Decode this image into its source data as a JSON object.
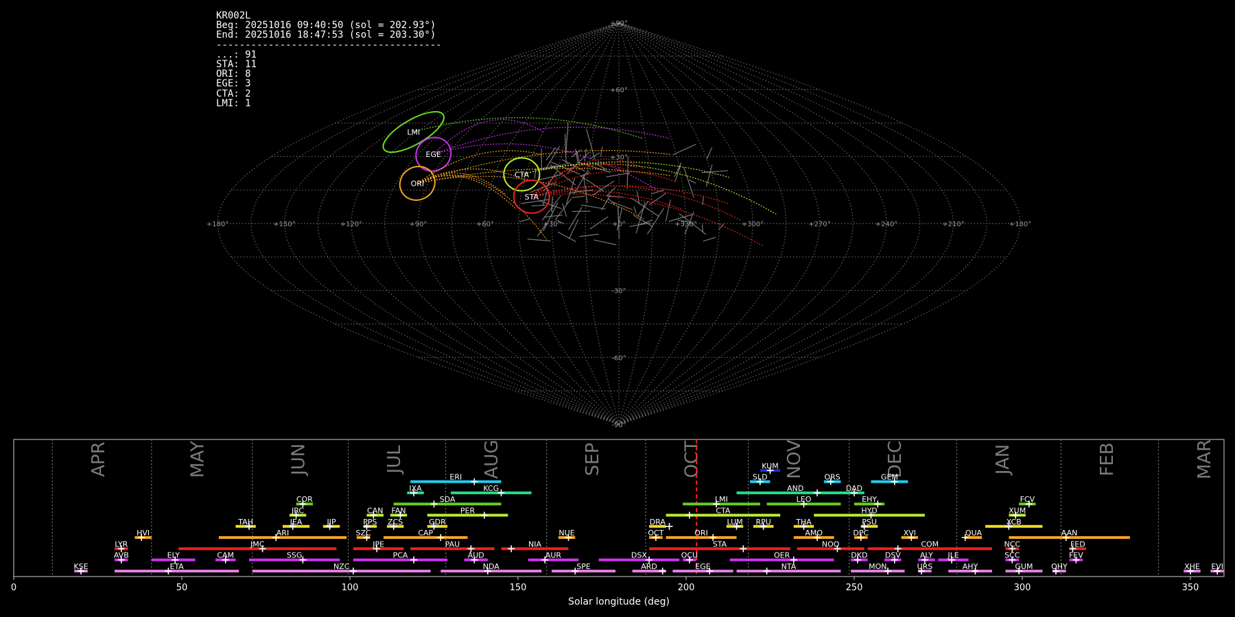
{
  "header": {
    "lines": [
      "KR002L",
      "Beg: 20251016 09:40:50 (sol = 202.93°)",
      "End: 20251016 18:47:53 (sol = 203.30°)",
      "---------------------------------------",
      "...: 91",
      "STA: 11",
      "ORI: 8",
      "EGE: 3",
      "CTA: 2",
      "LMI: 1"
    ]
  },
  "chart_data": [
    {
      "type": "scatter",
      "projection": "sinusoidal (all-sky radiant map)",
      "lon_ticks": [
        "+180°",
        "+150°",
        "+120°",
        "+90°",
        "+60°",
        "+30°",
        "+0°",
        "+330°",
        "+300°",
        "+270°",
        "+240°",
        "+210°",
        "+180°"
      ],
      "lat_ticks": [
        "+90°",
        "+60°",
        "+30°",
        "-30°",
        "-60°",
        "-90°"
      ],
      "sporadic_count": 91,
      "showers": [
        {
          "code": "LMI",
          "count": 1,
          "color": "#66dd22",
          "lon": 122,
          "lat": 41
        },
        {
          "code": "EGE",
          "count": 3,
          "color": "#cc33ee",
          "lon": 97,
          "lat": 31
        },
        {
          "code": "ORI",
          "count": 8,
          "color": "#f5a623",
          "lon": 95,
          "lat": 18
        },
        {
          "code": "CTA",
          "count": 2,
          "color": "#bbee33",
          "lon": 47,
          "lat": 22
        },
        {
          "code": "STA",
          "count": 11,
          "color": "#ee2222",
          "lon": 40,
          "lat": 12
        }
      ]
    },
    {
      "type": "gantt",
      "xlabel": "Solar longitude (deg)",
      "xlim": [
        0,
        360
      ],
      "x_ticks": [
        0,
        50,
        100,
        150,
        200,
        250,
        300,
        350
      ],
      "current_sol": 203.1,
      "months": [
        {
          "name": "APR",
          "start": 11.5
        },
        {
          "name": "MAY",
          "start": 41
        },
        {
          "name": "JUN",
          "start": 71
        },
        {
          "name": "JUL",
          "start": 99.5
        },
        {
          "name": "AUG",
          "start": 128.5
        },
        {
          "name": "SEP",
          "start": 158.5
        },
        {
          "name": "OCT",
          "start": 188
        },
        {
          "name": "NOV",
          "start": 218.5
        },
        {
          "name": "DEC",
          "start": 248.5
        },
        {
          "name": "JAN",
          "start": 280.5
        },
        {
          "name": "FEB",
          "start": 311.5
        },
        {
          "name": "MAR",
          "start": 340.5
        }
      ],
      "showers": [
        {
          "code": "KUM",
          "start": 222,
          "end": 228,
          "peak": 225,
          "row": 10,
          "color": "#1c2fd8"
        },
        {
          "code": "ERI",
          "start": 118,
          "end": 145,
          "peak": 137,
          "row": 9,
          "color": "#22ccee"
        },
        {
          "code": "SLD",
          "start": 219,
          "end": 225,
          "peak": 222,
          "row": 9,
          "color": "#22ccee"
        },
        {
          "code": "ORS",
          "start": 241,
          "end": 246,
          "peak": 243,
          "row": 9,
          "color": "#22ccee"
        },
        {
          "code": "GEM",
          "start": 255,
          "end": 266,
          "peak": 262,
          "row": 9,
          "color": "#22ccee"
        },
        {
          "code": "IXA",
          "start": 117,
          "end": 122,
          "peak": 119,
          "row": 8,
          "color": "#22dd88"
        },
        {
          "code": "KCG",
          "start": 130,
          "end": 154,
          "peak": 145,
          "row": 8,
          "color": "#22dd88"
        },
        {
          "code": "AND",
          "start": 215,
          "end": 250,
          "peak": 239,
          "row": 8,
          "color": "#22dd88"
        },
        {
          "code": "DAD",
          "start": 247,
          "end": 253,
          "peak": 250,
          "row": 8,
          "color": "#22dd88"
        },
        {
          "code": "COR",
          "start": 84,
          "end": 89,
          "peak": 86,
          "row": 7,
          "color": "#66cc22"
        },
        {
          "code": "SDA",
          "start": 113,
          "end": 145,
          "peak": 125,
          "row": 7,
          "color": "#66cc22"
        },
        {
          "code": "LMI",
          "start": 199,
          "end": 222,
          "peak": 209,
          "row": 7,
          "color": "#66cc22"
        },
        {
          "code": "LEO",
          "start": 224,
          "end": 246,
          "peak": 235,
          "row": 7,
          "color": "#66cc22"
        },
        {
          "code": "EHY",
          "start": 250,
          "end": 259,
          "peak": 257,
          "row": 7,
          "color": "#66cc22"
        },
        {
          "code": "FCV",
          "start": 299,
          "end": 304,
          "peak": 302,
          "row": 7,
          "color": "#66cc22"
        },
        {
          "code": "JRC",
          "start": 82,
          "end": 87,
          "peak": 84,
          "row": 6,
          "color": "#bbee33"
        },
        {
          "code": "CAN",
          "start": 105,
          "end": 110,
          "peak": 107,
          "row": 6,
          "color": "#bbee33"
        },
        {
          "code": "FAN",
          "start": 112,
          "end": 117,
          "peak": 115,
          "row": 6,
          "color": "#bbee33"
        },
        {
          "code": "PER",
          "start": 123,
          "end": 147,
          "peak": 140,
          "row": 6,
          "color": "#bbee33"
        },
        {
          "code": "CTA",
          "start": 194,
          "end": 228,
          "peak": 201,
          "row": 6,
          "color": "#bbee33"
        },
        {
          "code": "HYD",
          "start": 238,
          "end": 271,
          "peak": 255,
          "row": 6,
          "color": "#bbee33"
        },
        {
          "code": "XUM",
          "start": 296,
          "end": 301,
          "peak": 298,
          "row": 6,
          "color": "#bbee33"
        },
        {
          "code": "TAH",
          "start": 66,
          "end": 72,
          "peak": 70,
          "row": 5,
          "color": "#eedd22"
        },
        {
          "code": "JEA",
          "start": 80,
          "end": 88,
          "peak": 83,
          "row": 5,
          "color": "#eedd22"
        },
        {
          "code": "JIP",
          "start": 92,
          "end": 97,
          "peak": 94,
          "row": 5,
          "color": "#eedd22"
        },
        {
          "code": "PPS",
          "start": 104,
          "end": 108,
          "peak": 105,
          "row": 5,
          "color": "#eedd22"
        },
        {
          "code": "ZCS",
          "start": 111,
          "end": 116,
          "peak": 113,
          "row": 5,
          "color": "#eedd22"
        },
        {
          "code": "GDR",
          "start": 123,
          "end": 129,
          "peak": 125,
          "row": 5,
          "color": "#eedd22"
        },
        {
          "code": "DRA",
          "start": 189,
          "end": 194,
          "peak": 195,
          "row": 5,
          "color": "#eedd22"
        },
        {
          "code": "LUM",
          "start": 212,
          "end": 217,
          "peak": 215,
          "row": 5,
          "color": "#eedd22"
        },
        {
          "code": "RPU",
          "start": 220,
          "end": 226,
          "peak": 223,
          "row": 5,
          "color": "#eedd22"
        },
        {
          "code": "THA",
          "start": 232,
          "end": 238,
          "peak": 235,
          "row": 5,
          "color": "#eedd22"
        },
        {
          "code": "PSU",
          "start": 252,
          "end": 257,
          "peak": 253,
          "row": 5,
          "color": "#eedd22"
        },
        {
          "code": "XCB",
          "start": 289,
          "end": 306,
          "peak": 296,
          "row": 5,
          "color": "#eedd22"
        },
        {
          "code": "HVI",
          "start": 36,
          "end": 41,
          "peak": 38,
          "row": 4,
          "color": "#f5a623"
        },
        {
          "code": "ARI",
          "start": 61,
          "end": 99,
          "peak": 78,
          "row": 4,
          "color": "#f5a623"
        },
        {
          "code": "SZC",
          "start": 102,
          "end": 106,
          "peak": 105,
          "row": 4,
          "color": "#f5a623"
        },
        {
          "code": "CAP",
          "start": 110,
          "end": 135,
          "peak": 127,
          "row": 4,
          "color": "#f5a623"
        },
        {
          "code": "NUE",
          "start": 162,
          "end": 167,
          "peak": 165,
          "row": 4,
          "color": "#f5a623"
        },
        {
          "code": "OCT",
          "start": 189,
          "end": 193,
          "peak": 191,
          "row": 4,
          "color": "#f5a623"
        },
        {
          "code": "ORI",
          "start": 194,
          "end": 215,
          "peak": 208,
          "row": 4,
          "color": "#f5a623"
        },
        {
          "code": "AMO",
          "start": 232,
          "end": 244,
          "peak": 239,
          "row": 4,
          "color": "#f5a623"
        },
        {
          "code": "DPC",
          "start": 250,
          "end": 254,
          "peak": 252,
          "row": 4,
          "color": "#f5a623"
        },
        {
          "code": "XVI",
          "start": 264,
          "end": 269,
          "peak": 267,
          "row": 4,
          "color": "#f5a623"
        },
        {
          "code": "QUA",
          "start": 283,
          "end": 288,
          "peak": 283,
          "row": 4,
          "color": "#f5a623"
        },
        {
          "code": "AAN",
          "start": 296,
          "end": 332,
          "peak": 313,
          "row": 4,
          "color": "#f5a623"
        },
        {
          "code": "LYR",
          "start": 30,
          "end": 34,
          "peak": 32,
          "row": 3,
          "color": "#ee2222"
        },
        {
          "code": "JMC",
          "start": 49,
          "end": 96,
          "peak": 74,
          "row": 3,
          "color": "#ee2222"
        },
        {
          "code": "JPE",
          "start": 101,
          "end": 116,
          "peak": 108,
          "row": 3,
          "color": "#ee2222"
        },
        {
          "code": "PAU",
          "start": 118,
          "end": 143,
          "peak": 136,
          "row": 3,
          "color": "#ee2222"
        },
        {
          "code": "NIA",
          "start": 145,
          "end": 165,
          "peak": 148,
          "row": 3,
          "color": "#ee2222"
        },
        {
          "code": "STA",
          "start": 189,
          "end": 231,
          "peak": 217,
          "row": 3,
          "color": "#ee2222"
        },
        {
          "code": "NOO",
          "start": 233,
          "end": 253,
          "peak": 245,
          "row": 3,
          "color": "#ee2222"
        },
        {
          "code": "COM",
          "start": 254,
          "end": 291,
          "peak": 263,
          "row": 3,
          "color": "#ee2222"
        },
        {
          "code": "NCC",
          "start": 295,
          "end": 299,
          "peak": 297,
          "row": 3,
          "color": "#ee2222"
        },
        {
          "code": "FED",
          "start": 314,
          "end": 319,
          "peak": 315,
          "row": 3,
          "color": "#ee2222"
        },
        {
          "code": "AVB",
          "start": 30,
          "end": 34,
          "peak": 32,
          "row": 2,
          "color": "#cc33ee"
        },
        {
          "code": "ELY",
          "start": 41,
          "end": 54,
          "peak": 48,
          "row": 2,
          "color": "#cc33ee"
        },
        {
          "code": "CAM",
          "start": 60,
          "end": 66,
          "peak": 63,
          "row": 2,
          "color": "#cc33ee"
        },
        {
          "code": "SSG",
          "start": 70,
          "end": 97,
          "peak": 86,
          "row": 2,
          "color": "#cc33ee"
        },
        {
          "code": "PCA",
          "start": 101,
          "end": 129,
          "peak": 119,
          "row": 2,
          "color": "#cc33ee"
        },
        {
          "code": "AUD",
          "start": 134,
          "end": 141,
          "peak": 137,
          "row": 2,
          "color": "#cc33ee"
        },
        {
          "code": "AUR",
          "start": 153,
          "end": 168,
          "peak": 158,
          "row": 2,
          "color": "#cc33ee"
        },
        {
          "code": "DSX",
          "start": 174,
          "end": 198,
          "peak": 189,
          "row": 2,
          "color": "#cc33ee"
        },
        {
          "code": "OCU",
          "start": 199,
          "end": 203,
          "peak": 201,
          "row": 2,
          "color": "#cc33ee"
        },
        {
          "code": "OER",
          "start": 213,
          "end": 244,
          "peak": 232,
          "row": 2,
          "color": "#cc33ee"
        },
        {
          "code": "DKD",
          "start": 249,
          "end": 254,
          "peak": 251,
          "row": 2,
          "color": "#cc33ee"
        },
        {
          "code": "DSV",
          "start": 259,
          "end": 264,
          "peak": 262,
          "row": 2,
          "color": "#cc33ee"
        },
        {
          "code": "ALY",
          "start": 269,
          "end": 274,
          "peak": 271,
          "row": 2,
          "color": "#cc33ee"
        },
        {
          "code": "JLE",
          "start": 275,
          "end": 284,
          "peak": 279,
          "row": 2,
          "color": "#cc33ee"
        },
        {
          "code": "SCC",
          "start": 295,
          "end": 299,
          "peak": 297,
          "row": 2,
          "color": "#cc33ee"
        },
        {
          "code": "FEV",
          "start": 314,
          "end": 318,
          "peak": 316,
          "row": 2,
          "color": "#cc33ee"
        },
        {
          "code": "KSE",
          "start": 18,
          "end": 22,
          "peak": 20,
          "row": 1,
          "color": "#e07de0"
        },
        {
          "code": "ETA",
          "start": 30,
          "end": 67,
          "peak": 46,
          "row": 1,
          "color": "#e07de0"
        },
        {
          "code": "NZC",
          "start": 71,
          "end": 124,
          "peak": 101,
          "row": 1,
          "color": "#e07de0"
        },
        {
          "code": "NDA",
          "start": 127,
          "end": 157,
          "peak": 141,
          "row": 1,
          "color": "#e07de0"
        },
        {
          "code": "SPE",
          "start": 160,
          "end": 179,
          "peak": 167,
          "row": 1,
          "color": "#e07de0"
        },
        {
          "code": "ARD",
          "start": 184,
          "end": 194,
          "peak": 193,
          "row": 1,
          "color": "#e07de0"
        },
        {
          "code": "EGE",
          "start": 196,
          "end": 214,
          "peak": 207,
          "row": 1,
          "color": "#e07de0"
        },
        {
          "code": "NTA",
          "start": 215,
          "end": 246,
          "peak": 224,
          "row": 1,
          "color": "#e07de0"
        },
        {
          "code": "MON",
          "start": 249,
          "end": 265,
          "peak": 260,
          "row": 1,
          "color": "#e07de0"
        },
        {
          "code": "URS",
          "start": 269,
          "end": 273,
          "peak": 270,
          "row": 1,
          "color": "#e07de0"
        },
        {
          "code": "AHY",
          "start": 278,
          "end": 291,
          "peak": 286,
          "row": 1,
          "color": "#e07de0"
        },
        {
          "code": "GUM",
          "start": 295,
          "end": 306,
          "peak": 299,
          "row": 1,
          "color": "#e07de0"
        },
        {
          "code": "OHY",
          "start": 309,
          "end": 313,
          "peak": 310,
          "row": 1,
          "color": "#e07de0"
        },
        {
          "code": "XHE",
          "start": 348,
          "end": 353,
          "peak": 350,
          "row": 1,
          "color": "#e07de0"
        },
        {
          "code": "EVI",
          "start": 356,
          "end": 360,
          "peak": 358,
          "row": 1,
          "color": "#e07de0"
        }
      ]
    }
  ]
}
